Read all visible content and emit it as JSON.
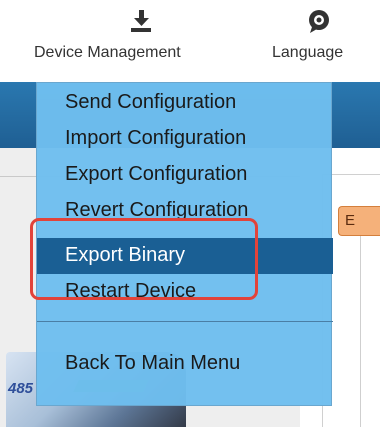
{
  "toolbar": {
    "device_management": {
      "label": "Device Management",
      "icon": "download-icon"
    },
    "language": {
      "label": "Language",
      "icon": "language-icon"
    }
  },
  "menu": {
    "items": [
      {
        "label": "Send Configuration"
      },
      {
        "label": "Import Configuration"
      },
      {
        "label": "Export Configuration"
      },
      {
        "label": "Revert Configuration"
      },
      {
        "label": "Export Binary",
        "selected": true
      },
      {
        "label": "Restart Device"
      },
      {
        "label": "Back To Main Menu"
      }
    ]
  },
  "background": {
    "right_tab_label": "E",
    "device_label": "485"
  },
  "colors": {
    "menu_bg": "#6ebeee",
    "menu_selected": "#1a5f94",
    "highlight": "#e2433a",
    "header_bar": "#2a78b0"
  }
}
